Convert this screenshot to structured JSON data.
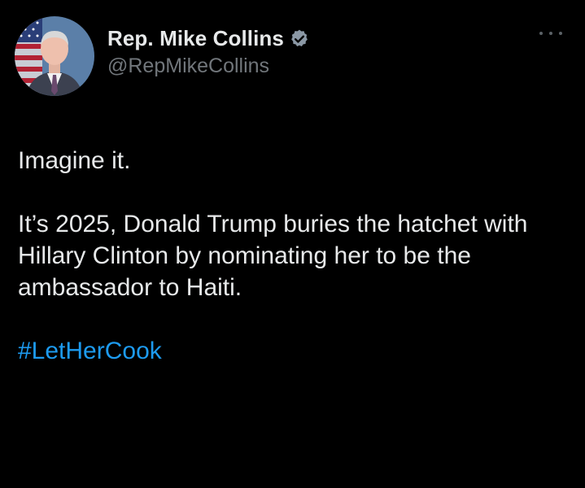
{
  "author": {
    "display_name": "Rep. Mike Collins",
    "handle": "@RepMikeCollins",
    "verified": true,
    "verified_color": "#8b98a5"
  },
  "tweet": {
    "line1": "Imagine it.",
    "line2": "It’s 2025, Donald Trump buries the hatchet with Hillary Clinton by nominating her to be the ambassador to Haiti.",
    "hashtag": "#LetHerCook",
    "hashtag_color": "#1d9bf0"
  },
  "icons": {
    "more": "more-horizontal-icon",
    "verified": "verified-badge-icon"
  }
}
